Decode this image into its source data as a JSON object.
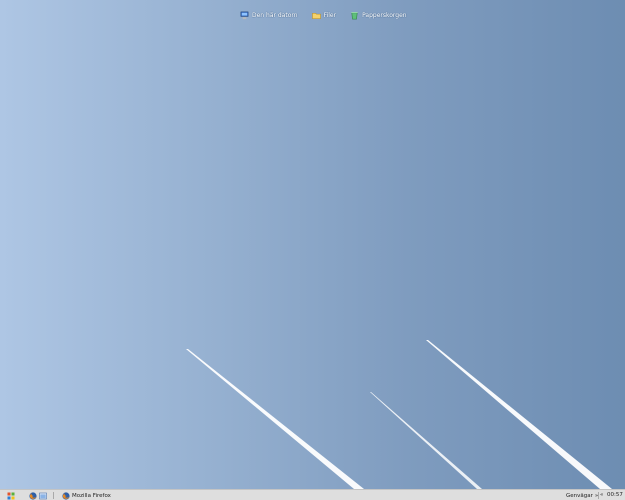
{
  "desktop": {
    "icons": [
      {
        "icon": "computer-icon",
        "label": "Den här datorn"
      },
      {
        "icon": "folder-icon",
        "label": "Filer"
      },
      {
        "icon": "recycle-bin-icon",
        "label": "Papperskorgen"
      }
    ]
  },
  "taskbar": {
    "start_icon": "start-menu-icon",
    "quick_launch": [
      "firefox-icon",
      "show-desktop-icon"
    ],
    "tasks": [
      {
        "icon": "firefox-icon",
        "label": "Mozilla Firefox"
      }
    ],
    "toolbar_label": "Genvägar",
    "toolbar_chevron": "»",
    "tray_chevron": "«",
    "clock": "00:57"
  },
  "colors": {
    "wallpaper_left": "#aec6e4",
    "wallpaper_right": "#6d8db2",
    "taskbar": "#dedede"
  }
}
